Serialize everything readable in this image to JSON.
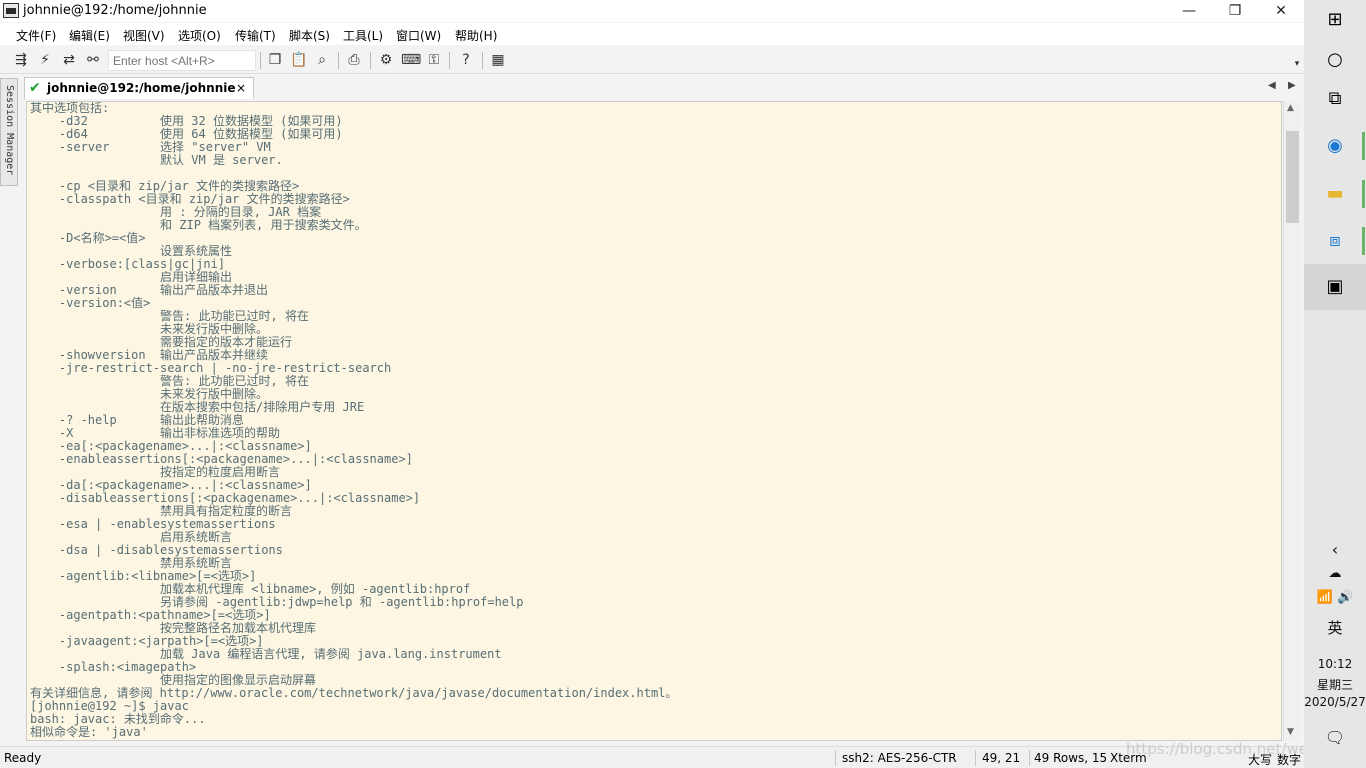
{
  "window": {
    "title": "johnnie@192:/home/johnnie",
    "minimize_glyph": "—",
    "maximize_glyph": "❐",
    "close_glyph": "✕"
  },
  "menu": [
    "文件(F)",
    "编辑(E)",
    "视图(V)",
    "选项(O)",
    "传输(T)",
    "脚本(S)",
    "工具(L)",
    "窗口(W)",
    "帮助(H)"
  ],
  "toolbar": {
    "host_placeholder": "Enter host <Alt+R>",
    "icons": [
      "connect-icon",
      "quick-connect-icon",
      "reconnect-icon",
      "disconnect-icon",
      "copy-icon",
      "paste-icon",
      "find-icon",
      "print-icon",
      "settings-icon",
      "keymap-icon",
      "sftp-icon",
      "help-icon",
      "sessions-icon"
    ]
  },
  "session_manager": {
    "label": "Session Manager"
  },
  "tab": {
    "label": "johnnie@192:/home/johnnie",
    "close": "×"
  },
  "terminal": {
    "lines": [
      "其中选项包括:",
      "    -d32          使用 32 位数据模型 (如果可用)",
      "    -d64          使用 64 位数据模型 (如果可用)",
      "    -server       选择 \"server\" VM",
      "                  默认 VM 是 server.",
      "",
      "    -cp <目录和 zip/jar 文件的类搜索路径>",
      "    -classpath <目录和 zip/jar 文件的类搜索路径>",
      "                  用 : 分隔的目录, JAR 档案",
      "                  和 ZIP 档案列表, 用于搜索类文件。",
      "    -D<名称>=<值>",
      "                  设置系统属性",
      "    -verbose:[class|gc|jni]",
      "                  启用详细输出",
      "    -version      输出产品版本并退出",
      "    -version:<值>",
      "                  警告: 此功能已过时, 将在",
      "                  未来发行版中删除。",
      "                  需要指定的版本才能运行",
      "    -showversion  输出产品版本并继续",
      "    -jre-restrict-search | -no-jre-restrict-search",
      "                  警告: 此功能已过时, 将在",
      "                  未来发行版中删除。",
      "                  在版本搜索中包括/排除用户专用 JRE",
      "    -? -help      输出此帮助消息",
      "    -X            输出非标准选项的帮助",
      "    -ea[:<packagename>...|:<classname>]",
      "    -enableassertions[:<packagename>...|:<classname>]",
      "                  按指定的粒度启用断言",
      "    -da[:<packagename>...|:<classname>]",
      "    -disableassertions[:<packagename>...|:<classname>]",
      "                  禁用具有指定粒度的断言",
      "    -esa | -enablesystemassertions",
      "                  启用系统断言",
      "    -dsa | -disablesystemassertions",
      "                  禁用系统断言",
      "    -agentlib:<libname>[=<选项>]",
      "                  加载本机代理库 <libname>, 例如 -agentlib:hprof",
      "                  另请参阅 -agentlib:jdwp=help 和 -agentlib:hprof=help",
      "    -agentpath:<pathname>[=<选项>]",
      "                  按完整路径名加载本机代理库",
      "    -javaagent:<jarpath>[=<选项>]",
      "                  加载 Java 编程语言代理, 请参阅 java.lang.instrument",
      "    -splash:<imagepath>",
      "                  使用指定的图像显示启动屏幕",
      "有关详细信息, 请参阅 http://www.oracle.com/technetwork/java/javase/documentation/index.html。",
      "[johnnie@192 ~]$ javac",
      "bash: javac: 未找到命令...",
      "相似命令是: 'java'"
    ]
  },
  "status": {
    "ready": "Ready",
    "cipher": "ssh2: AES-256-CTR",
    "cursor": "49,  21",
    "size": "49 Rows, 15",
    "term": "Xterm",
    "caps": "大写",
    "num": "数字"
  },
  "watermark": "https://blog.csdn.net/weixin_…",
  "taskbar": {
    "tray_ime": "英",
    "time": "10:12",
    "weekday": "星期三",
    "date": "2020/5/27"
  },
  "colors": {
    "terminal_bg": "#fdf6e3",
    "terminal_fg": "#586e75",
    "tab_check": "#1e9e2e"
  }
}
